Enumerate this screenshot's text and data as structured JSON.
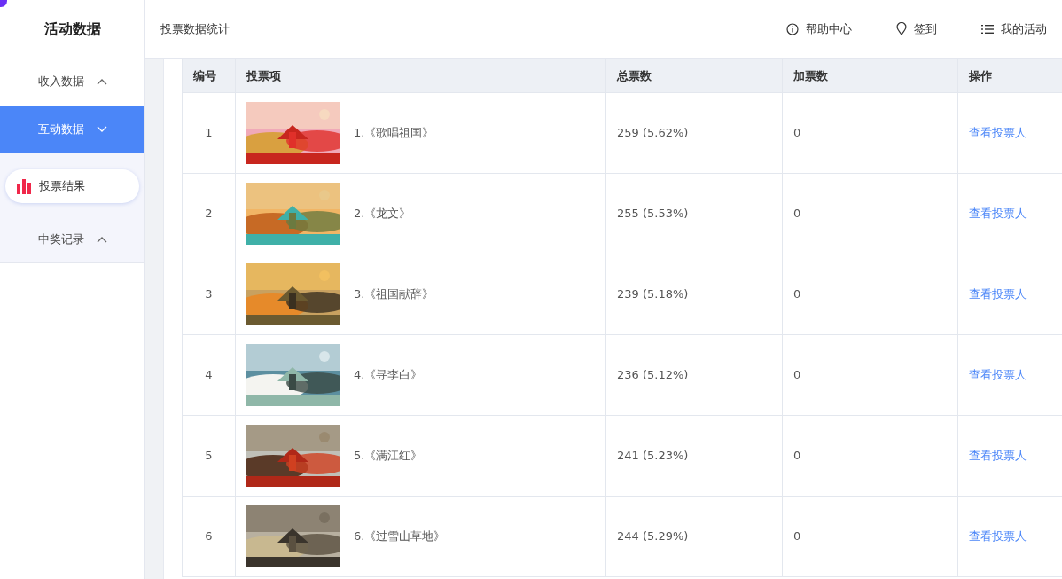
{
  "sidebar": {
    "title": "活动数据",
    "menu": [
      {
        "label": "收入数据",
        "selected": false,
        "expanded": false
      },
      {
        "label": "互动数据",
        "selected": true,
        "expanded": true,
        "children": [
          {
            "label": "投票结果",
            "selected": true
          }
        ]
      },
      {
        "label": "中奖记录",
        "selected": false,
        "expanded": false
      }
    ]
  },
  "header": {
    "title": "投票数据统计",
    "links": [
      {
        "kind": "info",
        "label": "帮助中心"
      },
      {
        "kind": "pin",
        "label": "签到"
      },
      {
        "kind": "list",
        "label": "我的活动"
      }
    ]
  },
  "table": {
    "columns": [
      "编号",
      "投票项",
      "总票数",
      "加票数",
      "操作"
    ],
    "rows": [
      {
        "number": "1",
        "item": "1.《歌唱祖国》",
        "total": "259 (5.62%)",
        "extra": "0",
        "action": "查看投票人"
      },
      {
        "number": "2",
        "item": "2.《龙文》",
        "total": "255 (5.53%)",
        "extra": "0",
        "action": "查看投票人"
      },
      {
        "number": "3",
        "item": "3.《祖国献辞》",
        "total": "239 (5.18%)",
        "extra": "0",
        "action": "查看投票人"
      },
      {
        "number": "4",
        "item": "4.《寻李白》",
        "total": "236 (5.12%)",
        "extra": "0",
        "action": "查看投票人"
      },
      {
        "number": "5",
        "item": "5.《满江红》",
        "total": "241 (5.23%)",
        "extra": "0",
        "action": "查看投票人"
      },
      {
        "number": "6",
        "item": "6.《过雪山草地》",
        "total": "244 (5.29%)",
        "extra": "0",
        "action": "查看投票人"
      }
    ]
  }
}
